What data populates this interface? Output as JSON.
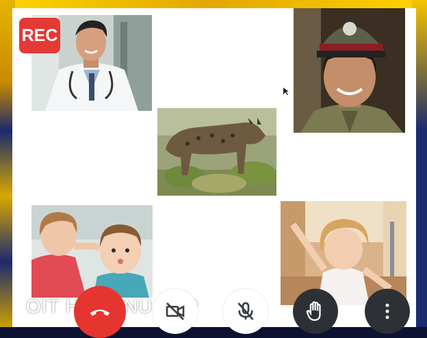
{
  "recording_badge": "REC",
  "participant_label": "OIT HEMANU ACP",
  "tiles": [
    {
      "id": "doctor",
      "description_icon": "doctor-video-icon"
    },
    {
      "id": "hyena",
      "description_icon": "hyena-video-icon"
    },
    {
      "id": "police-officer",
      "description_icon": "officer-video-icon"
    },
    {
      "id": "children",
      "description_icon": "children-video-icon"
    },
    {
      "id": "toddler",
      "description_icon": "toddler-video-icon"
    }
  ],
  "controls": [
    {
      "name": "end-call",
      "icon": "phone-hangup-icon",
      "color": "#e5352f"
    },
    {
      "name": "camera-toggle",
      "icon": "video-off-icon",
      "color": "#ffffff"
    },
    {
      "name": "mic-toggle",
      "icon": "mic-off-icon",
      "color": "#ffffff"
    },
    {
      "name": "raise-hand",
      "icon": "hand-icon",
      "color": "#2d3136"
    },
    {
      "name": "more-options",
      "icon": "more-vert-icon",
      "color": "#2d3136"
    }
  ]
}
